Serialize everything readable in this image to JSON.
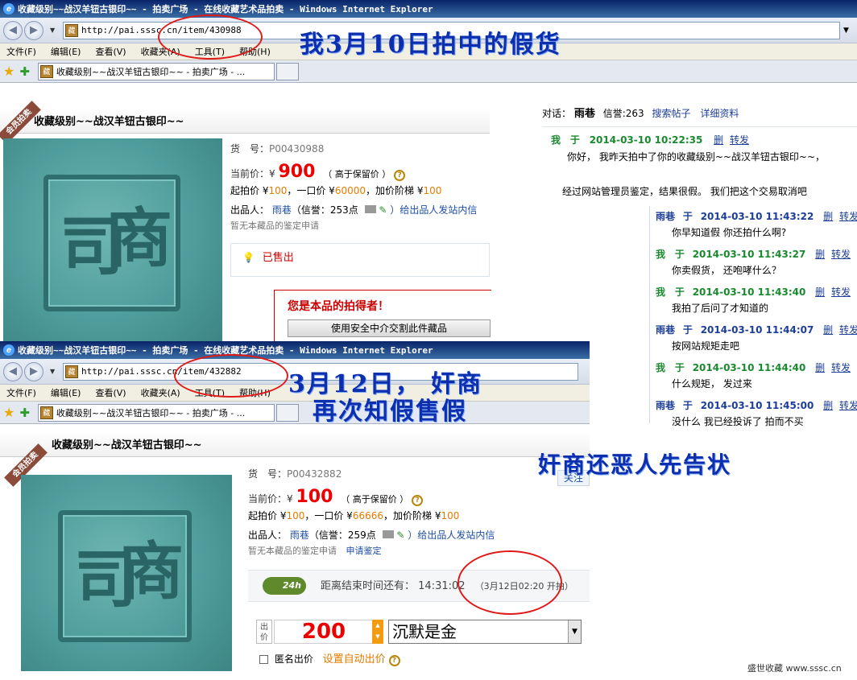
{
  "window1": {
    "title": "收藏级别~~战汉羊钮古银印~~ - 拍卖广场 - 在线收藏艺术品拍卖 - Windows Internet Explorer",
    "url": "http://pai.sssc.cn/item/430988",
    "menu": [
      "文件(F)",
      "编辑(E)",
      "查看(V)",
      "收藏夹(A)",
      "工具(T)",
      "帮助(H)"
    ],
    "tab_label": "收藏级别~~战汉羊钮古银印~~ - 拍卖广场 - ...",
    "page_title": "收藏级别~~战汉羊钮古银印~~",
    "banner": "会员拍卖",
    "item_no_label": "货　号：",
    "item_no": "P00430988",
    "price_label": "当前价：¥",
    "price": "900",
    "price_note": "（ 高于保留价 ）",
    "start_label": "起拍价 ¥",
    "start_price": "100",
    "buy_label": "，一口价 ¥",
    "buy_price": "60000",
    "step_label": "，加价阶梯 ¥",
    "step_price": "100",
    "seller_label": "出品人：",
    "seller": "雨巷",
    "credit": "（信誉：253点",
    "message_link": "）给出品人发站内信",
    "appraisal": "暂无本藏品的鉴定申请",
    "sold": "已售出",
    "winner": "您是本品的拍得者！",
    "escrow_btn": "使用安全中介交割此件藏品"
  },
  "window2": {
    "title": "收藏级别~~战汉羊钮古银印~~ - 拍卖广场 - 在线收藏艺术品拍卖 - Windows Internet Explorer",
    "url": "http://pai.sssc.cn/item/432882",
    "menu": [
      "文件(F)",
      "编辑(E)",
      "查看(V)",
      "收藏夹(A)",
      "工具(T)",
      "帮助(H)"
    ],
    "tab_label": "收藏级别~~战汉羊钮古银印~~ - 拍卖广场 - ...",
    "page_title": "收藏级别~~战汉羊钮古银印~~",
    "banner": "会员拍卖",
    "item_no_label": "货　号：",
    "item_no": "P00432882",
    "price_label": "当前价：¥",
    "price": "100",
    "price_note": "（ 高于保留价 ）",
    "start_label": "起拍价 ¥",
    "start_price": "100",
    "buy_label": "，一口价 ¥",
    "buy_price": "66666",
    "step_label": "，加价阶梯 ¥",
    "step_price": "100",
    "seller_label": "出品人：",
    "seller": "雨巷",
    "credit": "（信誉：259点",
    "message_link": "）给出品人发站内信",
    "appraisal": "暂无本藏品的鉴定申请",
    "appraisal_link": "申请鉴定",
    "timer_badge": "24h",
    "timer_label": "距离结束时间还有：",
    "timer_value": "14:31:02",
    "timer_note": "（3月12日02:20 开拍）",
    "bid_label": "出价",
    "bid_value": "200",
    "bid_message": "沉默是金",
    "anon_label": "匿名出价",
    "auto_bid": "设置自动出价",
    "follow": "关注"
  },
  "chat": {
    "header_label": "对话：",
    "header_name": "雨巷",
    "credit_label": "信誉:263",
    "posts_link": "搜索帖子",
    "detail_link": "详细资料",
    "messages": [
      {
        "who": "我",
        "yu": "于",
        "time": "2014-03-10 10:22:35",
        "del": "删",
        "fwd": "转发",
        "text": "你好， 我昨天拍中了你的收藏级别~~战汉羊钮古银印~~，"
      },
      {
        "who": "雨巷",
        "yu": "于",
        "time": "2014-03-10 11:43:22",
        "del": "删",
        "fwd": "转发",
        "text": "你早知道假 你还拍什么啊?"
      },
      {
        "who": "我",
        "yu": "于",
        "time": "2014-03-10 11:43:27",
        "del": "删",
        "fwd": "转发",
        "text": "你卖假货， 还咆哮什么？"
      },
      {
        "who": "我",
        "yu": "于",
        "time": "2014-03-10 11:43:40",
        "del": "删",
        "fwd": "转发",
        "text": "我拍了后问了才知道的"
      },
      {
        "who": "雨巷",
        "yu": "于",
        "time": "2014-03-10 11:44:07",
        "del": "删",
        "fwd": "转发",
        "text": "按网站规矩走吧"
      },
      {
        "who": "我",
        "yu": "于",
        "time": "2014-03-10 11:44:40",
        "del": "删",
        "fwd": "转发",
        "text": "什么规矩， 发过来"
      },
      {
        "who": "雨巷",
        "yu": "于",
        "time": "2014-03-10 11:45:00",
        "del": "删",
        "fwd": "转发",
        "text": "没什么 我已经投诉了 拍而不买"
      }
    ],
    "extra_line": "经过网站管理员鉴定，结果很假。 我们把这个交易取消吧"
  },
  "annotations": {
    "a1": "我3月10日拍中的假货",
    "a2_line1": "3月12日， 奸商",
    "a2_line2": "再次知假售假",
    "a3": "奸商还恶人先告状"
  },
  "watermark": "盛世收藏 www.sssc.cn",
  "colors": {
    "accent_red": "#e00000",
    "annotation_blue": "#0d2fae",
    "circle_red": "#e01919"
  }
}
